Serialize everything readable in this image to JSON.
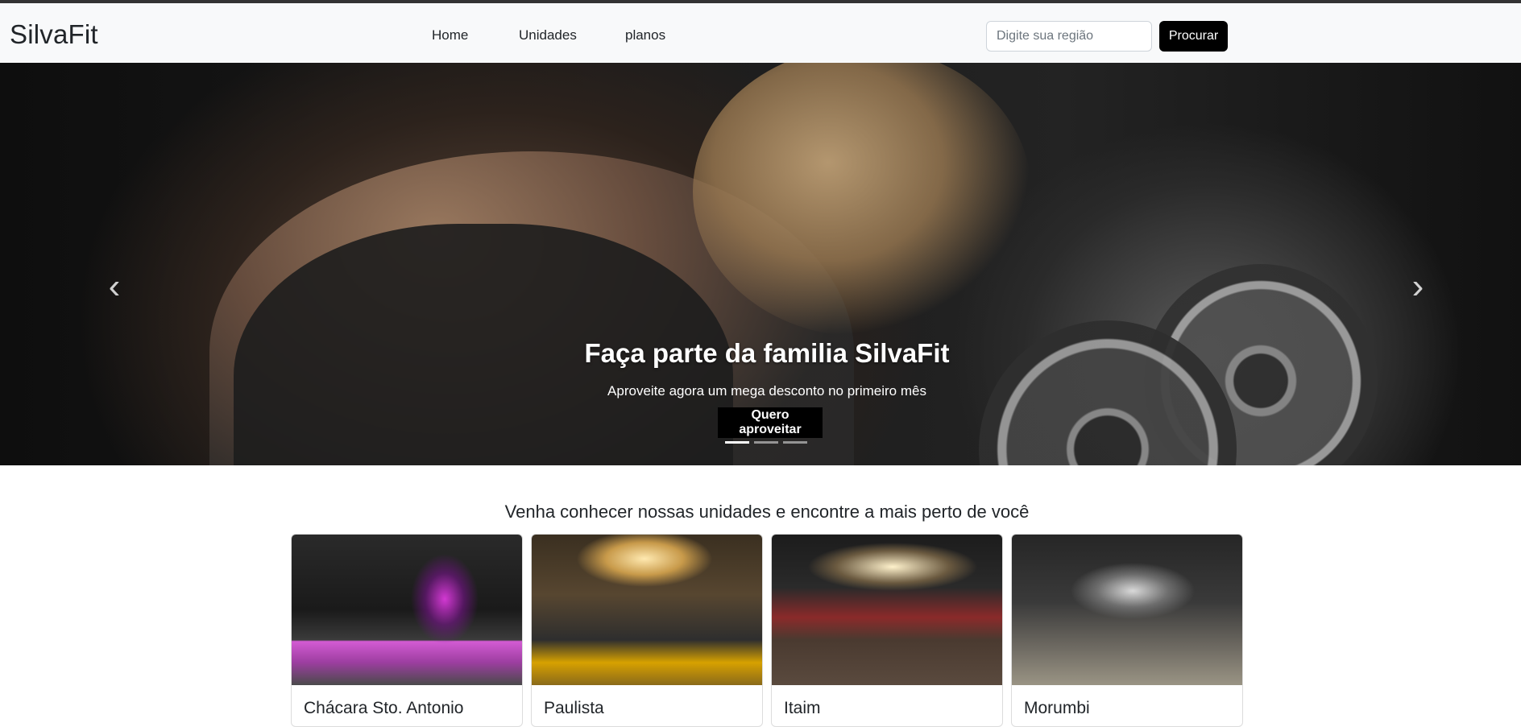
{
  "navbar": {
    "brand": "SilvaFit",
    "links": [
      {
        "label": "Home"
      },
      {
        "label": "Unidades"
      },
      {
        "label": "planos"
      }
    ],
    "search_placeholder": "Digite sua região",
    "search_button": "Procurar"
  },
  "hero": {
    "title": "Faça parte da familia SilvaFit",
    "subtitle": "Aproveite agora um mega desconto no primeiro mês",
    "cta": "Quero aproveitar",
    "slides": 3,
    "active_slide": 1,
    "prev_icon": "chevron-left-icon",
    "next_icon": "chevron-right-icon"
  },
  "units": {
    "heading": "Venha conhecer nossas unidades e encontre a mais perto de você",
    "cards": [
      {
        "name": "Chácara Sto. Antonio"
      },
      {
        "name": "Paulista"
      },
      {
        "name": "Itaim"
      },
      {
        "name": "Morumbi"
      }
    ]
  }
}
